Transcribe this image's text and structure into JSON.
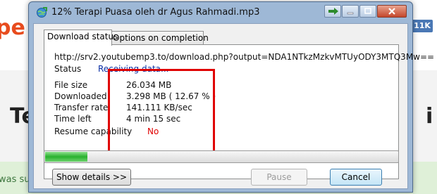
{
  "background": {
    "logo_text": "pe",
    "badge": "11K",
    "heading_left": "Te",
    "heading_right": "i",
    "success_text": "was su"
  },
  "window": {
    "title": "12% Terapi Puasa oleh dr Agus Rahmadi.mp3"
  },
  "tabs": [
    {
      "label": "Download status",
      "active": true
    },
    {
      "label": "Options on completion",
      "active": false
    }
  ],
  "status": {
    "url": "http://srv2.youtubemp3.to/download.php?output=NDA1NTkzMzkvMTUyODY3MTQ3Mw==",
    "status_label": "Status",
    "status_value": "Receiving data...",
    "file_size_label": "File size",
    "file_size_value": "26.034  MB",
    "downloaded_label": "Downloaded",
    "downloaded_value": "3.298  MB  ( 12.67 % )",
    "transfer_rate_label": "Transfer rate",
    "transfer_rate_value": "141.111  KB/sec",
    "time_left_label": "Time left",
    "time_left_value": "4 min 15 sec",
    "resume_label": "Resume capability",
    "resume_value": "No"
  },
  "progress": {
    "fraction": 0.1267
  },
  "buttons": {
    "show_details": "Show details >>",
    "pause": "Pause",
    "cancel": "Cancel"
  },
  "colors": {
    "progress": "#29b12e",
    "highlight": "#e00000",
    "status_value": "#0b2fa5"
  }
}
